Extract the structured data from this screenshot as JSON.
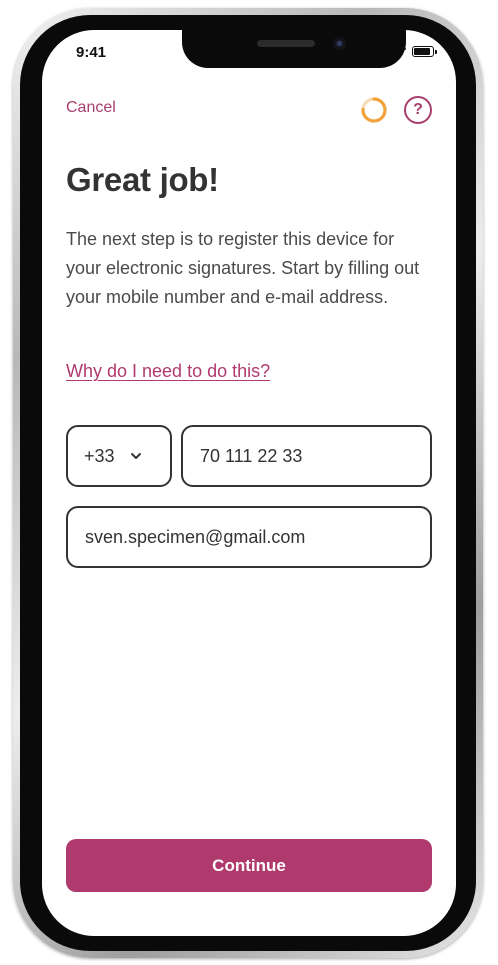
{
  "status_bar": {
    "time": "9:41"
  },
  "header": {
    "cancel_label": "Cancel",
    "progress_icon": "progress-ring-icon",
    "help_icon": "help-icon",
    "help_glyph": "?"
  },
  "content": {
    "title": "Great job!",
    "description": "The next step is to register this device for your electronic signatures. Start by filling out your mobile number and e-mail address.",
    "why_link": "Why do I need to do this?"
  },
  "form": {
    "country_code": "+33",
    "phone_number": "70 111 22 33",
    "email": "sven.specimen@gmail.com"
  },
  "footer": {
    "continue_label": "Continue"
  },
  "colors": {
    "accent": "#b03a6e",
    "progress": "#f2a23a",
    "text": "#333333"
  }
}
